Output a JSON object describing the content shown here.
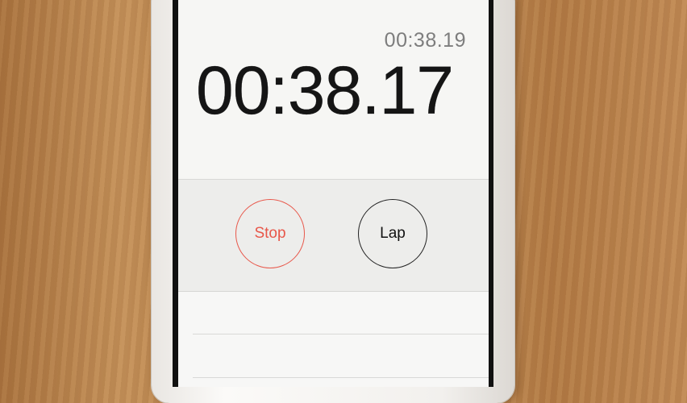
{
  "stopwatch": {
    "lap_time": "00:38.19",
    "main_time": "00:38.17"
  },
  "controls": {
    "stop_label": "Stop",
    "lap_label": "Lap"
  },
  "colors": {
    "stop_accent": "#e8574a",
    "lap_border": "#222222",
    "screen_bg": "#f4f4f2"
  },
  "laps": []
}
